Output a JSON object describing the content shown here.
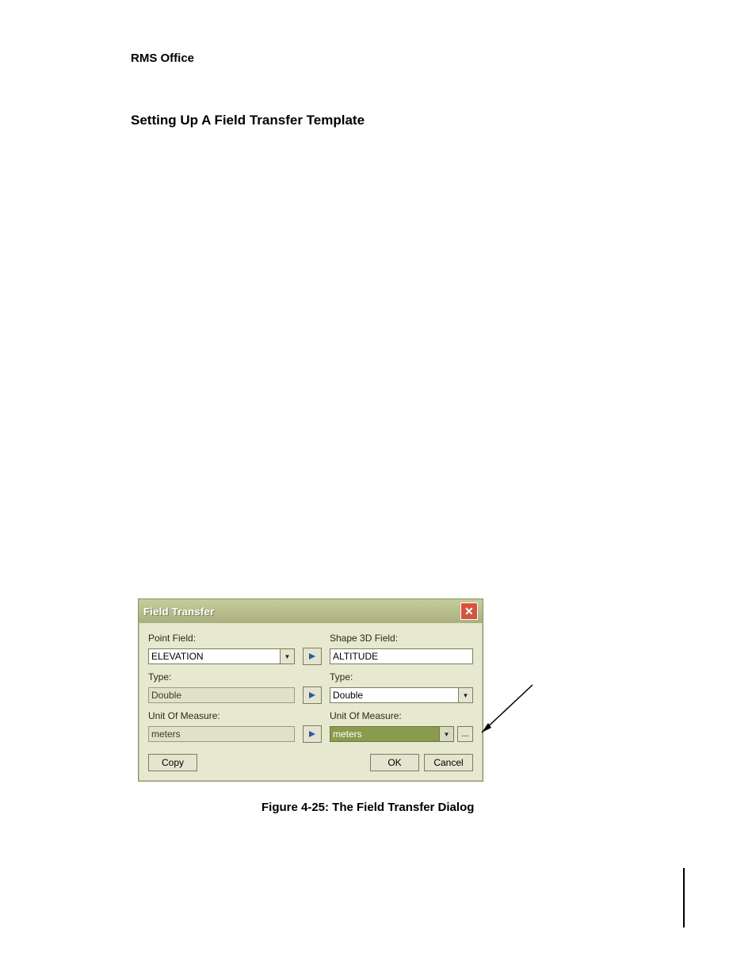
{
  "document": {
    "header": "RMS Office",
    "section_heading": "Setting Up A Field Transfer Template",
    "figure_caption": "Figure 4-25: The Field Transfer Dialog"
  },
  "dialog": {
    "title": "Field Transfer",
    "left": {
      "point_field_label": "Point Field:",
      "point_field_value": "ELEVATION",
      "type_label": "Type:",
      "type_value": "Double",
      "uom_label": "Unit Of Measure:",
      "uom_value": "meters"
    },
    "right": {
      "shape_field_label": "Shape 3D Field:",
      "shape_field_value": "ALTITUDE",
      "type_label": "Type:",
      "type_value": "Double",
      "uom_label": "Unit Of Measure:",
      "uom_value": "meters"
    },
    "buttons": {
      "copy": "Copy",
      "ok": "OK",
      "cancel": "Cancel",
      "ellipsis": "..."
    }
  }
}
